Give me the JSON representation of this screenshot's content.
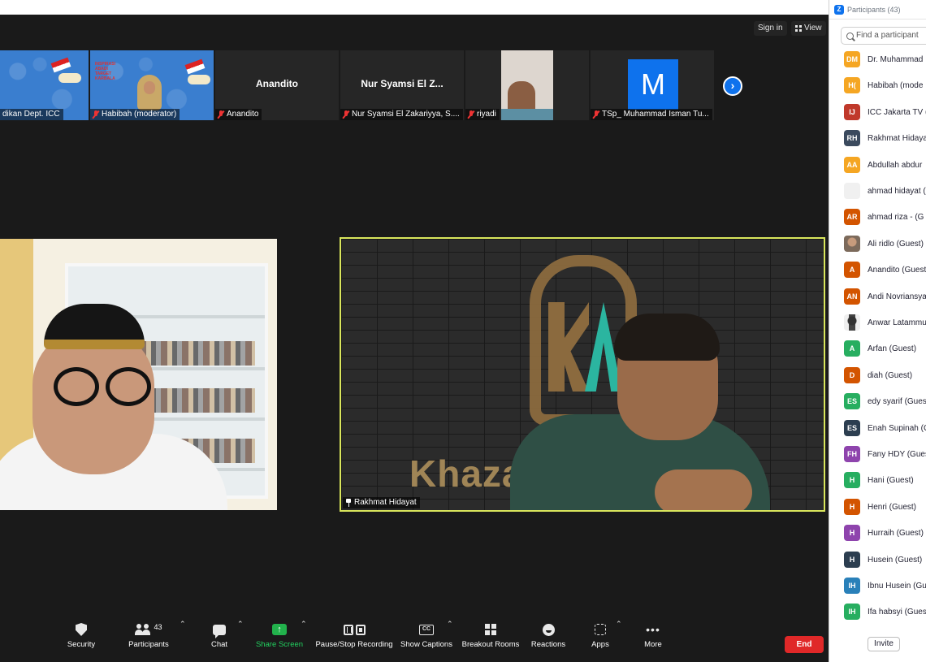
{
  "topbar": {
    "sign_in": "Sign in",
    "view": "View"
  },
  "thumbnails": [
    {
      "name": "dikan Dept. ICC",
      "muted": false
    },
    {
      "name": "Habibah (moderator)",
      "muted": true
    },
    {
      "name": "Anandito",
      "center": "Anandito",
      "muted": true
    },
    {
      "name": "Nur Syamsi El Zakariyya, S....",
      "center": "Nur Syamsi El Z...",
      "muted": true
    },
    {
      "name": "riyadi",
      "muted": true
    },
    {
      "name": "TSp_ Muhammad Isman Tu...",
      "avatar": "M",
      "muted": true
    }
  ],
  "poster_text": [
    "INSPIRASI",
    "ABADI",
    "TARGET",
    "KARBALA"
  ],
  "main_videos": {
    "right_label": "Rakhmat Hidayat",
    "right_backdrop_text": "Khaza"
  },
  "toolbar": {
    "security": "Security",
    "participants": "Participants",
    "participants_count": "43",
    "chat": "Chat",
    "share": "Share Screen",
    "record": "Pause/Stop Recording",
    "captions": "Show Captions",
    "breakout": "Breakout Rooms",
    "reactions": "Reactions",
    "apps": "Apps",
    "more": "More",
    "end": "End",
    "cc": "CC"
  },
  "panel": {
    "title": "Participants (43)",
    "search_placeholder": "Find a participant",
    "invite": "Invite",
    "participants": [
      {
        "initials": "DM",
        "name": "Dr. Muhammad",
        "color": "#f5a623"
      },
      {
        "initials": "H(",
        "name": "Habibah (mode",
        "color": "#f5a623"
      },
      {
        "initials": "IJ",
        "name": "ICC Jakarta TV (",
        "color": "#c0392b"
      },
      {
        "initials": "RH",
        "name": "Rakhmat Hidaya",
        "color": "#3b4a5e"
      },
      {
        "initials": "AA",
        "name": "Abdullah abdur",
        "color": "#f5a623"
      },
      {
        "initials": "",
        "name": "ahmad hidayat (",
        "color": "#f0f0f0"
      },
      {
        "initials": "AR",
        "name": "ahmad riza - (G",
        "color": "#d35400"
      },
      {
        "initials": "",
        "name": "Ali ridlo (Guest)",
        "color": "photo"
      },
      {
        "initials": "A",
        "name": "Anandito (Guest",
        "color": "#d35400"
      },
      {
        "initials": "AN",
        "name": "Andi Novriansya",
        "color": "#d35400"
      },
      {
        "initials": "",
        "name": "Anwar Latammu",
        "color": "photo2"
      },
      {
        "initials": "A",
        "name": "Arfan (Guest)",
        "color": "#27ae60"
      },
      {
        "initials": "D",
        "name": "diah (Guest)",
        "color": "#d35400"
      },
      {
        "initials": "ES",
        "name": "edy syarif (Gues",
        "color": "#27ae60"
      },
      {
        "initials": "ES",
        "name": "Enah Supinah (G",
        "color": "#2c3e50"
      },
      {
        "initials": "FH",
        "name": "Fany HDY (Gues",
        "color": "#8e44ad"
      },
      {
        "initials": "H",
        "name": "Hani (Guest)",
        "color": "#27ae60"
      },
      {
        "initials": "H",
        "name": "Henri (Guest)",
        "color": "#d35400"
      },
      {
        "initials": "H",
        "name": "Hurraih (Guest)",
        "color": "#8e44ad"
      },
      {
        "initials": "H",
        "name": "Husein (Guest)",
        "color": "#2c3e50"
      },
      {
        "initials": "IH",
        "name": "Ibnu Husein (Gu",
        "color": "#2980b9"
      },
      {
        "initials": "IH",
        "name": "Ifa habsyi (Gues",
        "color": "#27ae60"
      }
    ]
  },
  "icons": {
    "security": "shield-icon",
    "participants": "people-icon",
    "chat": "chat-bubble-icon",
    "share": "share-arrow-icon",
    "record": "pause-stop-icon",
    "captions": "cc-icon",
    "breakout": "grid-icon",
    "reactions": "smile-icon",
    "apps": "apps-icon",
    "more": "ellipsis-icon",
    "next": "chevron-right-icon"
  }
}
